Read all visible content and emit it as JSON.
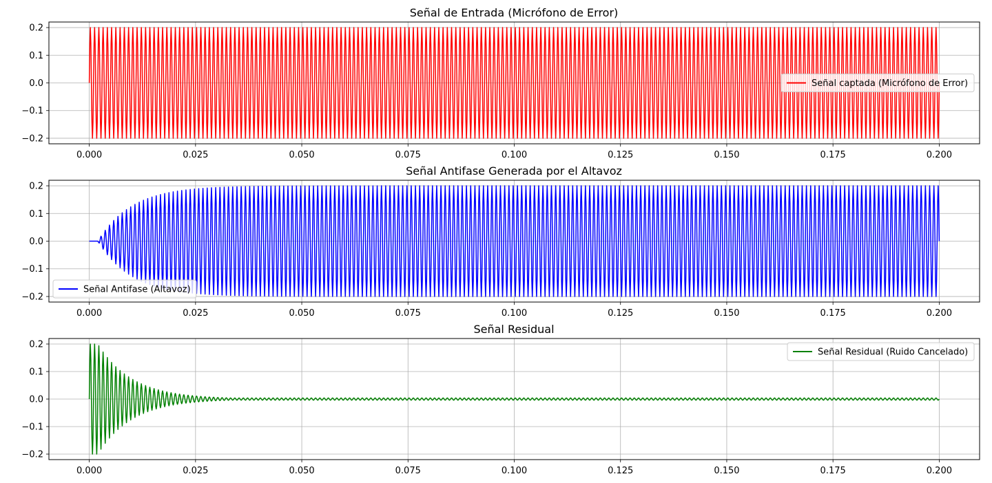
{
  "chart_data": [
    {
      "type": "line",
      "title": "Señal de Entrada (Micrófono de Error)",
      "xlim": [
        -0.0095,
        0.2095
      ],
      "ylim": [
        -0.22,
        0.22
      ],
      "xticks": [
        0.0,
        0.025,
        0.05,
        0.075,
        0.1,
        0.125,
        0.15,
        0.175,
        0.2
      ],
      "xtick_labels": [
        "0.000",
        "0.025",
        "0.050",
        "0.075",
        "0.100",
        "0.125",
        "0.150",
        "0.175",
        "0.200"
      ],
      "yticks": [
        -0.2,
        -0.1,
        0.0,
        0.1,
        0.2
      ],
      "ytick_labels": [
        "−0.2",
        "−0.1",
        "0.0",
        "0.1",
        "0.2"
      ],
      "grid": true,
      "legend_position": "center-right",
      "series": [
        {
          "name": "Señal captada (Micrófono de Error)",
          "color": "#ff0000",
          "signal": {
            "kind": "sine",
            "amplitude": 0.2,
            "frequency_hz": 1000,
            "t_start": 0.0,
            "t_end": 0.2,
            "envelope": "constant"
          }
        }
      ]
    },
    {
      "type": "line",
      "title": "Señal Antifase Generada por el Altavoz",
      "xlim": [
        -0.0095,
        0.2095
      ],
      "ylim": [
        -0.22,
        0.22
      ],
      "xticks": [
        0.0,
        0.025,
        0.05,
        0.075,
        0.1,
        0.125,
        0.15,
        0.175,
        0.2
      ],
      "xtick_labels": [
        "0.000",
        "0.025",
        "0.050",
        "0.075",
        "0.100",
        "0.125",
        "0.150",
        "0.175",
        "0.200"
      ],
      "yticks": [
        -0.2,
        -0.1,
        0.0,
        0.1,
        0.2
      ],
      "ytick_labels": [
        "−0.2",
        "−0.1",
        "0.0",
        "0.1",
        "0.2"
      ],
      "grid": true,
      "legend_position": "lower-left",
      "series": [
        {
          "name": "Señal Antifase (Altavoz)",
          "color": "#0000ff",
          "signal": {
            "kind": "sine",
            "amplitude": 0.2,
            "frequency_hz": 1000,
            "t_start": 0.0,
            "t_end": 0.2,
            "envelope": "rise",
            "onset_delay": 0.002,
            "time_constant": 0.008
          }
        }
      ]
    },
    {
      "type": "line",
      "title": "Señal Residual",
      "xlim": [
        -0.0095,
        0.2095
      ],
      "ylim": [
        -0.22,
        0.22
      ],
      "xticks": [
        0.0,
        0.025,
        0.05,
        0.075,
        0.1,
        0.125,
        0.15,
        0.175,
        0.2
      ],
      "xtick_labels": [
        "0.000",
        "0.025",
        "0.050",
        "0.075",
        "0.100",
        "0.125",
        "0.150",
        "0.175",
        "0.200"
      ],
      "yticks": [
        -0.2,
        -0.1,
        0.0,
        0.1,
        0.2
      ],
      "ytick_labels": [
        "−0.2",
        "−0.1",
        "0.0",
        "0.1",
        "0.2"
      ],
      "grid": true,
      "legend_position": "upper-right",
      "series": [
        {
          "name": "Señal Residual (Ruido Cancelado)",
          "color": "#008000",
          "signal": {
            "kind": "sine",
            "amplitude": 0.2,
            "frequency_hz": 1000,
            "t_start": 0.0,
            "t_end": 0.2,
            "envelope": "decay",
            "onset_delay": 0.002,
            "time_constant": 0.008,
            "residual_floor": 0.004
          }
        }
      ]
    }
  ]
}
